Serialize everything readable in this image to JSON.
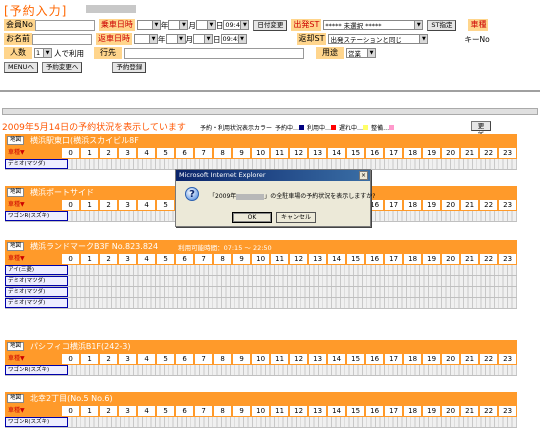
{
  "page_title": "[予約入力]",
  "form": {
    "member_label": "会員No",
    "name_label": "お名前",
    "people_label": "人数",
    "people_value": "1",
    "people_suffix": "人で利用",
    "dest_label": "行先",
    "usage_label": "用途",
    "usage_value": "営業",
    "board_label": "乗車日時",
    "return_label": "返車日時",
    "year_suffix": "年",
    "month_suffix": "月",
    "day_suffix": "日",
    "board_time": "09:45",
    "return_time": "09:45",
    "date_change_label": "日付変更",
    "depart_st_label": "出発ST",
    "depart_st_value": "***** 未選択 *****",
    "st_assign_label": "ST指定",
    "return_st_label": "返却ST",
    "return_st_value": "出発ステーションと同じ",
    "car_type_label": "車種",
    "key_no_label": "キーNo",
    "menu_button": "MENUへ",
    "change_button": "予約変更へ",
    "register_button": "予約登録"
  },
  "status_line": "2009年5月14日の予約状況を表示しています",
  "legend": {
    "title": "予約・利用状況表示カラー",
    "items": [
      {
        "label": "予約中…",
        "color": "#000080"
      },
      {
        "label": "利用中…",
        "color": "#ff0000"
      },
      {
        "label": "遅れ中…",
        "color": "#ffff66"
      },
      {
        "label": "整備…",
        "color": "#ff99cc"
      }
    ]
  },
  "refresh_button": "更新",
  "map_label": "地図",
  "car_type_header": "車種▼",
  "hours": [
    "0",
    "1",
    "2",
    "3",
    "4",
    "5",
    "6",
    "7",
    "8",
    "9",
    "10",
    "11",
    "12",
    "13",
    "14",
    "15",
    "16",
    "17",
    "18",
    "19",
    "20",
    "21",
    "22",
    "23"
  ],
  "locations": [
    {
      "name": "横浜駅東口(横浜スカイビル8F",
      "extra": "",
      "cars": [
        "デミオ(マツダ)"
      ]
    },
    {
      "name": "横浜ポートサイド",
      "extra": "",
      "cars": [
        "ワゴンR(スズキ)"
      ]
    },
    {
      "name": "横浜ランドマークB3F No.823.824",
      "extra": "利用可能時間：07:15 〜 22:50",
      "cars": [
        "アイ(三菱)",
        "デミオ(マツダ)",
        "デミオ(マツダ)",
        "デミオ(マツダ)"
      ]
    },
    {
      "name": "パシフィコ横浜B1F(242-3)",
      "extra": "",
      "cars": [
        "ワゴンR(スズキ)"
      ]
    },
    {
      "name": "北幸2丁目(No.5 No.6)",
      "extra": "",
      "cars": [
        "ワゴンR(スズキ)"
      ]
    }
  ],
  "dialog": {
    "title": "Microsoft Internet Explorer",
    "close": "×",
    "icon": "question-icon",
    "message_prefix": "「2009年",
    "message_suffix": "」の全駐車場の予約状況を表示しますか?",
    "ok": "OK",
    "cancel": "キャンセル"
  }
}
